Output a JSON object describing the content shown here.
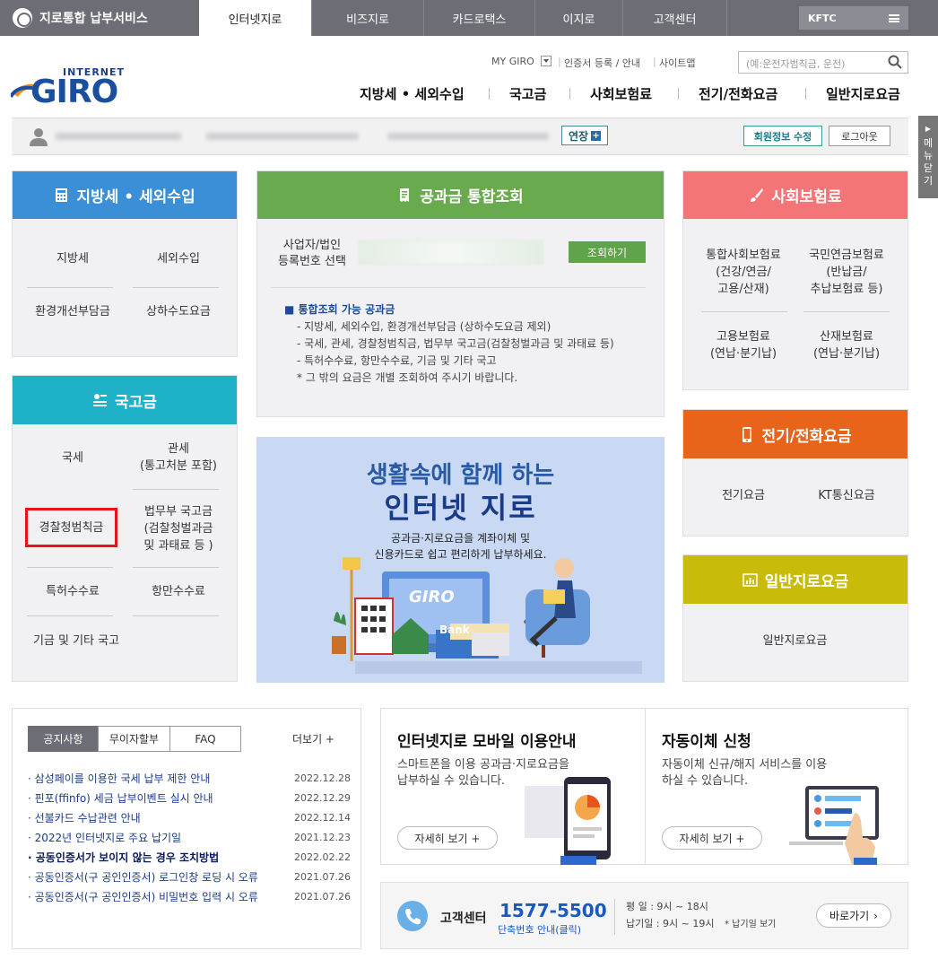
{
  "topbar": {
    "brand": "지로통합 납부서비스",
    "tabs": [
      "인터넷지로",
      "비즈지로",
      "카드로택스",
      "이지로",
      "고객센터"
    ],
    "kftc": "KFTC"
  },
  "header": {
    "logo_top": "INTERNET",
    "logo_main": "GIRO",
    "util": [
      "MY GIRO",
      "인증서 등록 / 안내",
      "사이트맵"
    ],
    "search_placeholder": "(예:운전자범칙금, 운전)",
    "gnb": [
      "지방세 • 세외수입",
      "국고금",
      "사회보험료",
      "전기/전화요금",
      "일반지로요금"
    ]
  },
  "userbar": {
    "extend": "연장",
    "edit_info": "회원정보 수정",
    "logout": "로그아웃"
  },
  "side_tab": "메뉴닫기",
  "local_tax": {
    "title": "지방세 • 세외수입",
    "color": "#3a8fd6",
    "items": [
      "지방세",
      "세외수입",
      "환경개선부담금",
      "상하수도요금"
    ]
  },
  "national": {
    "title": "국고금",
    "color": "#1fb1c8",
    "items": [
      "국세",
      "관세\n(통고처분 포함)",
      "경찰청범칙금",
      "법무부 국고금\n(검찰청벌과금\n및 과태료 등 )",
      "특허수수료",
      "항만수수료",
      "기금 및 기타 국고"
    ]
  },
  "integrated": {
    "title": "공과금 통합조회",
    "color": "#6aaa4e",
    "label": "사업자/법인\n등록번호 선택",
    "button": "조회하기",
    "notes_title": "■ 통합조회 가능 공과금",
    "notes": [
      "- 지방세, 세외수입, 환경개선부담금 (상하수도요금 제외)",
      "- 국세, 관세, 경찰청범칙금, 법무부 국고금(검찰청벌과금 및 과태료 등)",
      "- 특허수수료, 항만수수료, 기금 및 기타 국고",
      "* 그 밖의 요금은 개별 조회하여 주시기 바랍니다."
    ]
  },
  "banner": {
    "line1": "생활속에 함께 하는",
    "line2": "인터넷 지로",
    "desc1": "공과금·지로요금을 계좌이체 및",
    "desc2": "신용카드로 쉽고 편리하게 납부하세요.",
    "screen_logo": "GIRO",
    "bank": "Bank"
  },
  "social": {
    "title": "사회보험료",
    "color": "#f47577",
    "items": [
      "통합사회보험료\n(건강/연금/\n고용/산재)",
      "국민연금보험료\n(반납금/\n추납보험료 등)",
      "고용보험료\n(연납·분기납)",
      "산재보험료\n(연납·분기납)"
    ]
  },
  "phone": {
    "title": "전기/전화요금",
    "color": "#e8641b",
    "items": [
      "전기요금",
      "KT통신요금"
    ]
  },
  "general": {
    "title": "일반지로요금",
    "color": "#c9bb0a",
    "items": [
      "일반지로요금"
    ]
  },
  "notice": {
    "tabs": [
      "공지사항",
      "무이자할부",
      "FAQ"
    ],
    "more": "더보기 +",
    "rows": [
      {
        "title": "삼성페이를 이용한 국세 납부 제한 안내",
        "date": "2022.12.28"
      },
      {
        "title": "핀포(ffinfo) 세금 납부이벤트 실시 안내",
        "date": "2022.12.29"
      },
      {
        "title": "선불카드 수납관련 안내",
        "date": "2022.12.14"
      },
      {
        "title": "2022년 인터넷지로 주요 납기일",
        "date": "2021.12.23"
      },
      {
        "title": "공동인증서가 보이지 않는 경우 조치방법",
        "date": "2022.02.22"
      },
      {
        "title": "공동인증서(구 공인인증서) 로그인창 로딩 시 오류",
        "date": "2021.07.26"
      },
      {
        "title": "공동인증서(구 공인인증서) 비밀번호 입력 시 오류",
        "date": "2021.07.26"
      }
    ]
  },
  "mobile": {
    "title": "인터넷지로 모바일 이용안내",
    "desc1": "스마트폰을 이용 공과금·지로요금을",
    "desc2": "납부하실 수 있습니다.",
    "more": "자세히 보기  +"
  },
  "autopay": {
    "title": "자동이체 신청",
    "desc1": "자동이체 신규/해지 서비스를 이용",
    "desc2": "하실 수 있습니다.",
    "more": "자세히 보기  +"
  },
  "cs": {
    "label": "고객센터",
    "phone": "1577-5500",
    "short": "단축번호 안내(클릭)",
    "weekday": "평    일 : 9시 ~ 18시",
    "due": "납기일 : 9시 ~ 19시",
    "due_note": "* 납기일 보기",
    "go": "바로가기"
  }
}
